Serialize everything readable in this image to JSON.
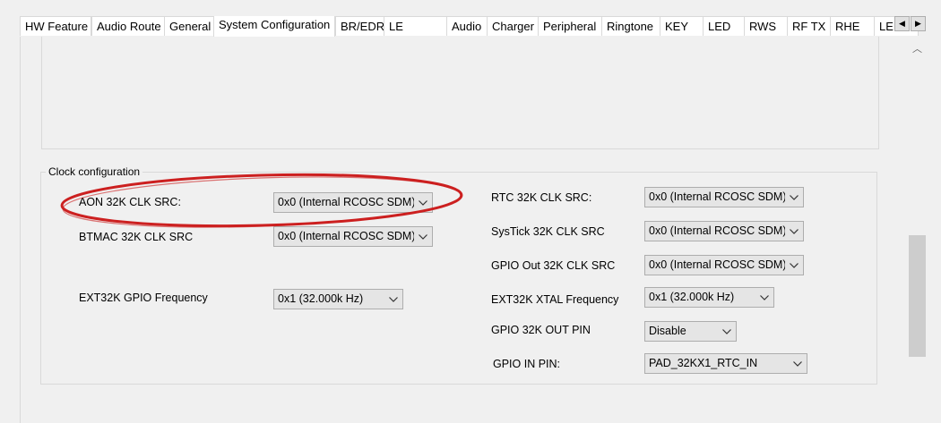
{
  "tabs": [
    {
      "label": "HW Feature"
    },
    {
      "label": "Audio Route"
    },
    {
      "label": "General"
    },
    {
      "label": "System Configuration"
    },
    {
      "label": "BR/EDR"
    },
    {
      "label": "LE"
    },
    {
      "label": "Audio"
    },
    {
      "label": "Charger"
    },
    {
      "label": "Peripheral"
    },
    {
      "label": "Ringtone"
    },
    {
      "label": "KEY"
    },
    {
      "label": "LED"
    },
    {
      "label": "RWS"
    },
    {
      "label": "RF TX"
    },
    {
      "label": "RHE"
    },
    {
      "label": "LE Audio"
    }
  ],
  "active_tab": "System Configuration",
  "tab_scroll": {
    "left": "◀",
    "right": "▶"
  },
  "scroll_up_glyph": "︿",
  "clock": {
    "group_label": "Clock configuration",
    "aon_label": "AON 32K CLK SRC:",
    "aon_value": "0x0 (Internal RCOSC SDM)",
    "btmac_label": "BTMAC 32K CLK SRC",
    "btmac_value": "0x0 (Internal RCOSC SDM)",
    "ext_gpio_label": "EXT32K GPIO Frequency",
    "ext_gpio_value": "0x1 (32.000k Hz)",
    "rtc_label": "RTC 32K CLK SRC:",
    "rtc_value": "0x0 (Internal RCOSC SDM)",
    "systick_label": "SysTick 32K CLK SRC",
    "systick_value": "0x0 (Internal RCOSC SDM)",
    "gpio_out_label": "GPIO Out 32K CLK SRC",
    "gpio_out_value": "0x0 (Internal RCOSC SDM)",
    "xtal_label": "EXT32K XTAL Frequency",
    "xtal_value": "0x1 (32.000k Hz)",
    "out_pin_label": "GPIO 32K OUT PIN",
    "out_pin_value": "Disable",
    "in_pin_label": "GPIO IN PIN:",
    "in_pin_value": "PAD_32KX1_RTC_IN"
  },
  "colors": {
    "highlight_ellipse": "#cc2020",
    "window_bg": "#f0f0f0",
    "combo_bg": "#e5e5e5",
    "border": "#d9d9d9"
  }
}
